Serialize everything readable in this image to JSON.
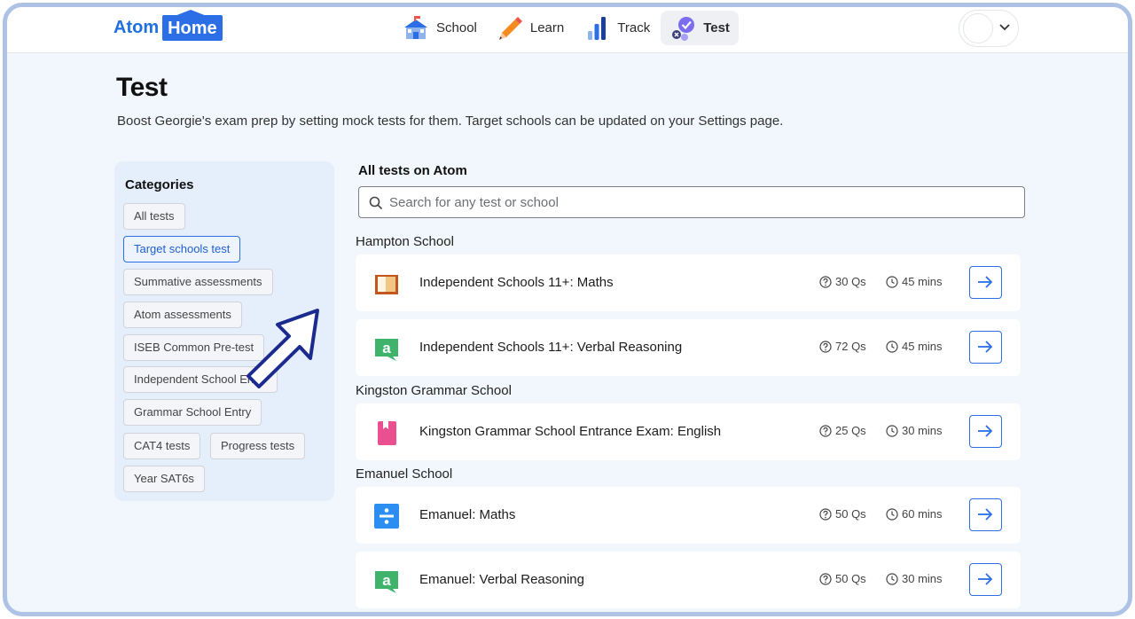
{
  "header": {
    "logo_atom": "Atom",
    "logo_home": "Home",
    "nav": [
      {
        "label": "School"
      },
      {
        "label": "Learn"
      },
      {
        "label": "Track"
      },
      {
        "label": "Test"
      }
    ]
  },
  "page": {
    "title": "Test",
    "description": "Boost Georgie's exam prep by setting mock tests for them. Target schools can be updated on your Settings page."
  },
  "categories": {
    "title": "Categories",
    "items": [
      {
        "label": "All tests"
      },
      {
        "label": "Target schools test"
      },
      {
        "label": "Summative assessments"
      },
      {
        "label": "Atom assessments"
      },
      {
        "label": "ISEB Common Pre-test"
      },
      {
        "label": "Independent School Entry"
      },
      {
        "label": "Grammar School Entry"
      },
      {
        "label": "CAT4 tests"
      },
      {
        "label": "Progress tests"
      },
      {
        "label": "Year SAT6s"
      }
    ]
  },
  "results": {
    "title": "All tests on Atom",
    "search_placeholder": "Search for any test or school",
    "groups": [
      {
        "school": "Hampton School"
      },
      {
        "school": "Kingston Grammar School"
      },
      {
        "school": "Emanuel School"
      }
    ],
    "tests": [
      {
        "name": "Independent Schools 11+: Maths",
        "questions": "30 Qs",
        "duration": "45 mins",
        "icon": "book-icon"
      },
      {
        "name": "Independent Schools 11+: Verbal Reasoning",
        "questions": "72 Qs",
        "duration": "45 mins",
        "icon": "letter-a-icon"
      },
      {
        "name": "Kingston Grammar School Entrance Exam: English",
        "questions": "25 Qs",
        "duration": "30 mins",
        "icon": "bookmark-book-icon"
      },
      {
        "name": "Emanuel: Maths",
        "questions": "50 Qs",
        "duration": "60 mins",
        "icon": "divide-icon"
      },
      {
        "name": "Emanuel: Verbal Reasoning",
        "questions": "50 Qs",
        "duration": "30 mins",
        "icon": "letter-a-icon"
      }
    ]
  },
  "colors": {
    "accent": "#2b6ee6",
    "background": "#f2f7fd",
    "frame": "#aec2e6"
  }
}
